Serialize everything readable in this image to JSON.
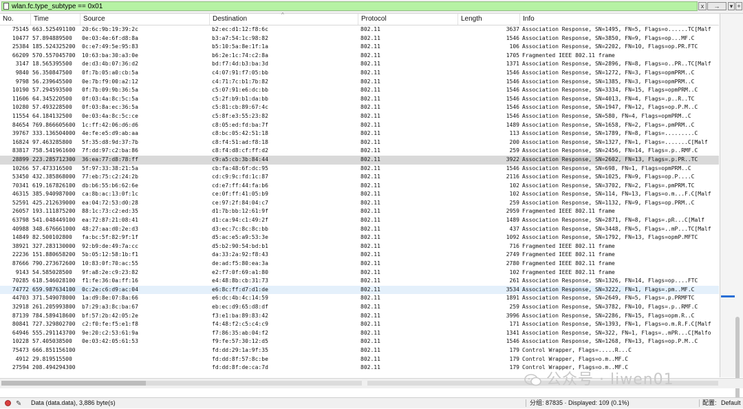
{
  "filter": {
    "value": "wlan.fc.type_subtype == 0x01",
    "clear_label": "x",
    "apply_label": "→",
    "drop_label": "▾",
    "add_label": "+"
  },
  "columns": [
    "No.",
    "Time",
    "Source",
    "Destination",
    "Protocol",
    "Length",
    "Info"
  ],
  "packets": [
    {
      "no": "75145",
      "time": "663.525491100",
      "src": "20:6c:9b:19:39:2c",
      "dst": "b2:ec:d1:12:f8:6c",
      "proto": "802.11",
      "len": "3637",
      "info": "Association Response, SN=1495, FN=5, Flags=o......TC[Malf"
    },
    {
      "no": "10477",
      "time": "57.894889500",
      "src": "0e:03:4e:6f:d8:8a",
      "dst": "b3:a7:54:1c:98:82",
      "proto": "802.11",
      "len": "1546",
      "info": "Association Response, SN=3850, FN=9, Flags=op...MF.C"
    },
    {
      "no": "25384",
      "time": "185.524325200",
      "src": "0c:e7:49:5e:95:83",
      "dst": "b5:10:5a:8e:1f:1a",
      "proto": "802.11",
      "len": "106",
      "info": "Association Response, SN=2202, FN=10, Flags=op.PR.FTC"
    },
    {
      "no": "66209",
      "time": "570.557045700",
      "src": "10:63:ba:30:a3:0e",
      "dst": "b6:2e:1c:74:c2:8a",
      "proto": "802.11",
      "len": "1705",
      "info": "Fragmented IEEE 802.11 frame"
    },
    {
      "no": "3147",
      "time": "18.565395500",
      "src": "de:d3:4b:07:36:d2",
      "dst": "bd:f7:4d:b3:ba:3d",
      "proto": "802.11",
      "len": "1371",
      "info": "Association Response, SN=2896, FN=8, Flags=o..PR..TC[Malf"
    },
    {
      "no": "9840",
      "time": "56.350847500",
      "src": "0f:7b:05:a0:cb:5a",
      "dst": "c4:07:91:f7:05:bb",
      "proto": "802.11",
      "len": "1546",
      "info": "Association Response, SN=1272, FN=3, Flags=opmPRM..C"
    },
    {
      "no": "9798",
      "time": "56.239645500",
      "src": "0e:7b:f9:00:a2:12",
      "dst": "c4:71:7c:b1:7b:82",
      "proto": "802.11",
      "len": "1546",
      "info": "Association Response, SN=1385, FN=3, Flags=opmPRM..C"
    },
    {
      "no": "10190",
      "time": "57.294593500",
      "src": "0f:7b:09:9b:36:5a",
      "dst": "c5:07:91:e6:dc:bb",
      "proto": "802.11",
      "len": "1546",
      "info": "Association Response, SN=3334, FN=15, Flags=opmPRM..C"
    },
    {
      "no": "11606",
      "time": "64.345220500",
      "src": "0f:03:4a:8c:5c:5a",
      "dst": "c5:2f:b9:b1:da:bb",
      "proto": "802.11",
      "len": "1546",
      "info": "Association Response, SN=4013, FN=4, Flags=.p..R..TC"
    },
    {
      "no": "10280",
      "time": "57.493228500",
      "src": "0f:03:8a:ec:36:5a",
      "dst": "c5:81:cb:89:67:4c",
      "proto": "802.11",
      "len": "1546",
      "info": "Association Response, SN=1947, FN=12, Flags=op.P.M..C"
    },
    {
      "no": "11554",
      "time": "64.184132500",
      "src": "0e:03:4a:8c:5c:ce",
      "dst": "c5:8f:e3:55:23:82",
      "proto": "802.11",
      "len": "1546",
      "info": "Association Response, SN=580, FN=4, Flags=opmPRM..C"
    },
    {
      "no": "84654",
      "time": "769.866605600",
      "src": "1c:ff:42:06:d6:d6",
      "dst": "c8:05:ed:fd:ba:7f",
      "proto": "802.11",
      "len": "1489",
      "info": "Association Response, SN=1658, FN=2, Flags=.pmPRM..C"
    },
    {
      "no": "39767",
      "time": "333.136504000",
      "src": "4e:fe:e5:d9:ab:aa",
      "dst": "c8:bc:05:42:51:18",
      "proto": "802.11",
      "len": "113",
      "info": "Association Response, SN=1789, FN=8, Flags=.........C"
    },
    {
      "no": "16824",
      "time": "97.463285800",
      "src": "5f:35:d8:9d:37:7b",
      "dst": "c8:f4:51:ad:f8:18",
      "proto": "802.11",
      "len": "200",
      "info": "Association Response, SN=1327, FN=1, Flags=.......C[Malf"
    },
    {
      "no": "83817",
      "time": "758.541961600",
      "src": "7f:dd:97:c2:ba:86",
      "dst": "c8:f4:d8:cf:ff:d2",
      "proto": "802.11",
      "len": "259",
      "info": "Association Response, SN=2456, FN=14, Flags=.p..RMF.C"
    },
    {
      "no": "28899",
      "time": "223.285712300",
      "src": "36:ea:77:d8:78:ff",
      "dst": "c9:a5:cb:3b:84:44",
      "proto": "802.11",
      "len": "3922",
      "info": "Association Response, SN=2602, FN=13, Flags=.p.PR..TC"
    },
    {
      "no": "10266",
      "time": "57.473316500",
      "src": "5f:97:33:38:21:5a",
      "dst": "cb:fa:48:6f:dc:95",
      "proto": "802.11",
      "len": "1546",
      "info": "Association Response, SN=698, FN=1, Flags=opmPRM..C"
    },
    {
      "no": "53450",
      "time": "432.385868000",
      "src": "77:eb:75:c2:24:2b",
      "dst": "cd:c9:9c:fd:1c:87",
      "proto": "802.11",
      "len": "2116",
      "info": "Association Response, SN=1025, FN=9, Flags=op.P....C"
    },
    {
      "no": "70341",
      "time": "619.167826100",
      "src": "db:b6:55:b6:62:6e",
      "dst": "cd:e7:ff:44:fa:b6",
      "proto": "802.11",
      "len": "102",
      "info": "Association Response, SN=3702, FN=2, Flags=.pmPRM.TC"
    },
    {
      "no": "46315",
      "time": "385.940987000",
      "src": "ca:8b:ac:13:0f:1c",
      "dst": "ce:0f:ff:41:05:b9",
      "proto": "802.11",
      "len": "102",
      "info": "Association Response, SN=114, FN=13, Flags=o.m...F.C[Malf"
    },
    {
      "no": "52591",
      "time": "425.212639000",
      "src": "ea:04:72:53:d0:28",
      "dst": "ce:97:2f:84:04:c7",
      "proto": "802.11",
      "len": "259",
      "info": "Association Response, SN=1132, FN=9, Flags=op.PRM..C"
    },
    {
      "no": "26057",
      "time": "193.111875200",
      "src": "88:1c:73:c2:ed:35",
      "dst": "d1:7b:bb:12:61:9f",
      "proto": "802.11",
      "len": "2959",
      "info": "Fragmented IEEE 802.11 frame"
    },
    {
      "no": "63798",
      "time": "541.048449100",
      "src": "ea:72:87:21:08:41",
      "dst": "d1:ca:94:c1:49:2f",
      "proto": "802.11",
      "len": "1489",
      "info": "Association Response, SN=2871, FN=8, Flags=.pR...C[Malf"
    },
    {
      "no": "40988",
      "time": "348.676661000",
      "src": "48:27:aa:d0:2e:d3",
      "dst": "d3:ec:7c:8c:8c:bb",
      "proto": "802.11",
      "len": "437",
      "info": "Association Response, SN=3448, FN=5, Flags=..mP...TC[Malf"
    },
    {
      "no": "14849",
      "time": "82.500102800",
      "src": "fa:bc:5f:82:9f:1f",
      "dst": "d5:ac:e5:a9:53:3e",
      "proto": "802.11",
      "len": "1092",
      "info": "Association Response, SN=1792, FN=13, Flags=opmP.MFTC"
    },
    {
      "no": "38921",
      "time": "327.283130000",
      "src": "92:b9:de:49:7a:cc",
      "dst": "d5:b2:90:54:bd:b1",
      "proto": "802.11",
      "len": "716",
      "info": "Fragmented IEEE 802.11 frame"
    },
    {
      "no": "22236",
      "time": "151.880658200",
      "src": "5b:05:12:58:1b:f1",
      "dst": "da:33:2a:92:f8:43",
      "proto": "802.11",
      "len": "2749",
      "info": "Fragmented IEEE 802.11 frame"
    },
    {
      "no": "87666",
      "time": "790.273672600",
      "src": "10:83:0f:70:ac:55",
      "dst": "de:ad:f5:80:ea:3a",
      "proto": "802.11",
      "len": "2780",
      "info": "Fragmented IEEE 802.11 frame"
    },
    {
      "no": "9143",
      "time": "54.585028500",
      "src": "9f:a8:2e:c9:23:82",
      "dst": "e2:f7:0f:69:a1:80",
      "proto": "802.11",
      "len": "102",
      "info": "Fragmented IEEE 802.11 frame"
    },
    {
      "no": "70285",
      "time": "618.546028100",
      "src": "f1:fe:36:0a:ff:16",
      "dst": "e4:48:8b:cb:31:73",
      "proto": "802.11",
      "len": "261",
      "info": "Association Response, SN=1326, FN=14, Flags=op....FTC"
    },
    {
      "no": "74772",
      "time": "659.987634100",
      "src": "0c:2e:c6:d9:ac:04",
      "dst": "e6:8c:ff:d7:d1:de",
      "proto": "802.11",
      "len": "3534",
      "info": "Association Response, SN=3222, FN=1, Flags=.pm..MF.C"
    },
    {
      "no": "44703",
      "time": "371.549078000",
      "src": "1a:d9:8e:07:8a:66",
      "dst": "e6:dc:4b:4c:14:59",
      "proto": "802.11",
      "len": "1891",
      "info": "Association Response, SN=2649, FN=5, Flags=.p.PRMFTC"
    },
    {
      "no": "32918",
      "time": "261.205993800",
      "src": "b7:29:a3:8c:ba:67",
      "dst": "eb:ec:d9:65:d8:df",
      "proto": "802.11",
      "len": "259",
      "info": "Association Response, SN=3782, FN=10, Flags=.p..RMF.C"
    },
    {
      "no": "87139",
      "time": "784.589418600",
      "src": "bf:57:2b:42:05:2e",
      "dst": "f3:e1:ba:89:83:42",
      "proto": "802.11",
      "len": "3996",
      "info": "Association Response, SN=2286, FN=15, Flags=opm.R..C"
    },
    {
      "no": "80841",
      "time": "727.329802700",
      "src": "c2:f0:fe:f5:e1:f8",
      "dst": "f4:48:f2:c5:c4:c9",
      "proto": "802.11",
      "len": "171",
      "info": "Association Response, SN=1393, FN=1, Flags=o.m.R.F.C[Malf"
    },
    {
      "no": "64946",
      "time": "555.291143700",
      "src": "9e:20:c2:53:61:9a",
      "dst": "f7:86:35:ab:04:f2",
      "proto": "802.11",
      "len": "1341",
      "info": "Association Response, SN=322, FN=1, Flags=..mPR...C[Malfo"
    },
    {
      "no": "10228",
      "time": "57.405038500",
      "src": "0e:03:42:05:61:53",
      "dst": "f9:fe:57:30:12:d5",
      "proto": "802.11",
      "len": "1546",
      "info": "Association Response, SN=1268, FN=13, Flags=op.P.M..C"
    },
    {
      "no": "75473",
      "time": "666.851156100",
      "src": "",
      "dst": "fd:dd:29:1a:9f:35",
      "proto": "802.11",
      "len": "179",
      "info": "Control Wrapper, Flags=.....R...C"
    },
    {
      "no": "4912",
      "time": "29.819515500",
      "src": "",
      "dst": "fd:dd:8f:57:8c:be",
      "proto": "802.11",
      "len": "179",
      "info": "Control Wrapper, Flags=o.m..MF.C"
    },
    {
      "no": "27594",
      "time": "208.494294300",
      "src": "",
      "dst": "fd:dd:8f:de:ca:7d",
      "proto": "802.11",
      "len": "179",
      "info": "Control Wrapper, Flags=o.m..MF.C"
    }
  ],
  "status": {
    "data": "Data (data.data), 3,886 byte(s)",
    "counts": "分组: 87835 · Displayed: 109 (0.1%)",
    "config_label": "配置:",
    "profile": "Default"
  },
  "watermark": "公众号 · liwen01"
}
